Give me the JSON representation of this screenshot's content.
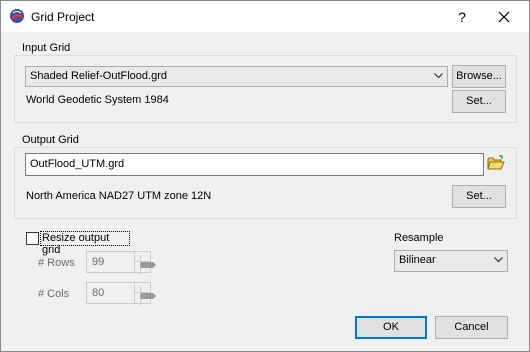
{
  "window": {
    "title": "Grid Project",
    "help_label": "?"
  },
  "input_grid": {
    "group_label": "Input Grid",
    "selected_grid": "Shaded Relief-OutFlood.grd",
    "browse_label": "Browse...",
    "projection": "World Geodetic System 1984",
    "set_label": "Set..."
  },
  "output_grid": {
    "group_label": "Output Grid",
    "filename": "OutFlood_UTM.grd",
    "projection": "North America NAD27 UTM zone 12N",
    "set_label": "Set..."
  },
  "resize": {
    "checkbox_label": "Resize output grid",
    "checked": false,
    "rows_label": "# Rows",
    "rows_value": "99",
    "cols_label": "# Cols",
    "cols_value": "80"
  },
  "resample": {
    "label": "Resample",
    "selected": "Bilinear"
  },
  "buttons": {
    "ok_label": "OK",
    "cancel_label": "Cancel"
  },
  "icons": {
    "app": "globe-app-icon",
    "close": "close-icon",
    "folder": "open-folder-icon",
    "dropdown": "chevron-down-icon"
  }
}
